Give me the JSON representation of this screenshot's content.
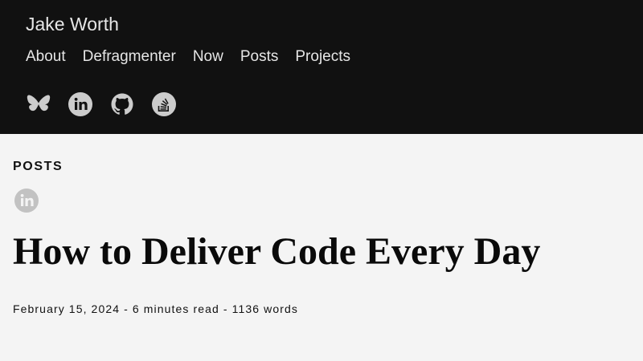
{
  "header": {
    "site_title": "Jake Worth",
    "nav": [
      {
        "label": "About"
      },
      {
        "label": "Defragmenter"
      },
      {
        "label": "Now"
      },
      {
        "label": "Posts"
      },
      {
        "label": "Projects"
      }
    ],
    "social_icons": [
      "bluesky-icon",
      "linkedin-icon",
      "github-icon",
      "stackoverflow-icon"
    ],
    "background_color": "#111111",
    "icon_color": "#cccccc"
  },
  "main": {
    "section_label": "POSTS",
    "share_icon": "linkedin-icon",
    "post": {
      "title": "How to Deliver Code Every Day",
      "date": "February 15, 2024",
      "read_time": "6 minutes read",
      "word_count": "1136 words"
    },
    "background_color": "#f4f4f4"
  }
}
